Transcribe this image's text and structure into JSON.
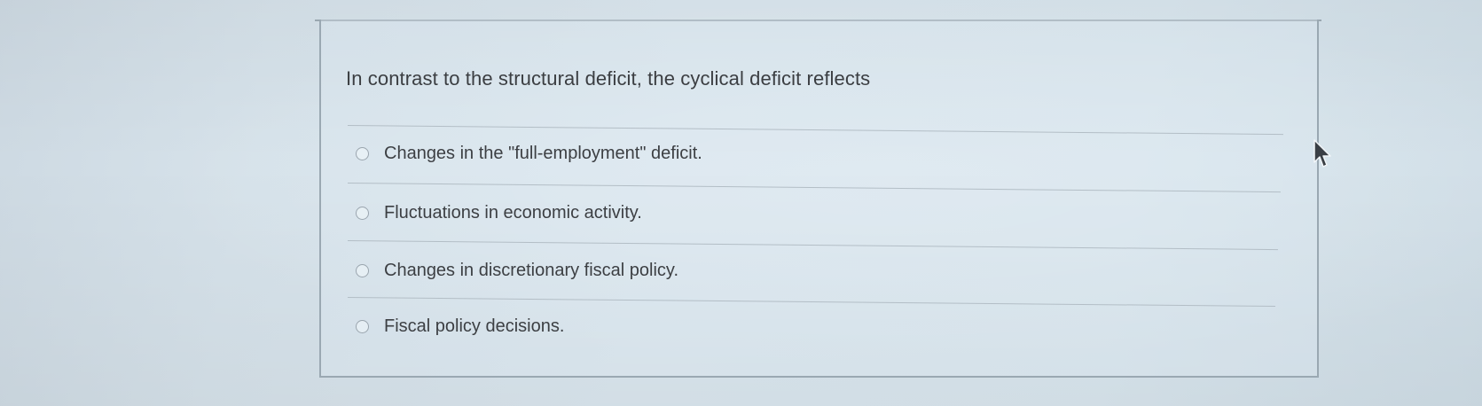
{
  "quiz": {
    "question": "In contrast to the structural deficit, the cyclical deficit reflects",
    "options": [
      {
        "label": "Changes in the \"full-employment\" deficit.",
        "selected": false
      },
      {
        "label": "Fluctuations in economic activity.",
        "selected": false
      },
      {
        "label": "Changes in discretionary fiscal policy.",
        "selected": false
      },
      {
        "label": "Fiscal policy decisions.",
        "selected": false
      }
    ]
  },
  "icons": {
    "cursor": "mouse-pointer-icon",
    "radio": "radio-unchecked-icon"
  }
}
